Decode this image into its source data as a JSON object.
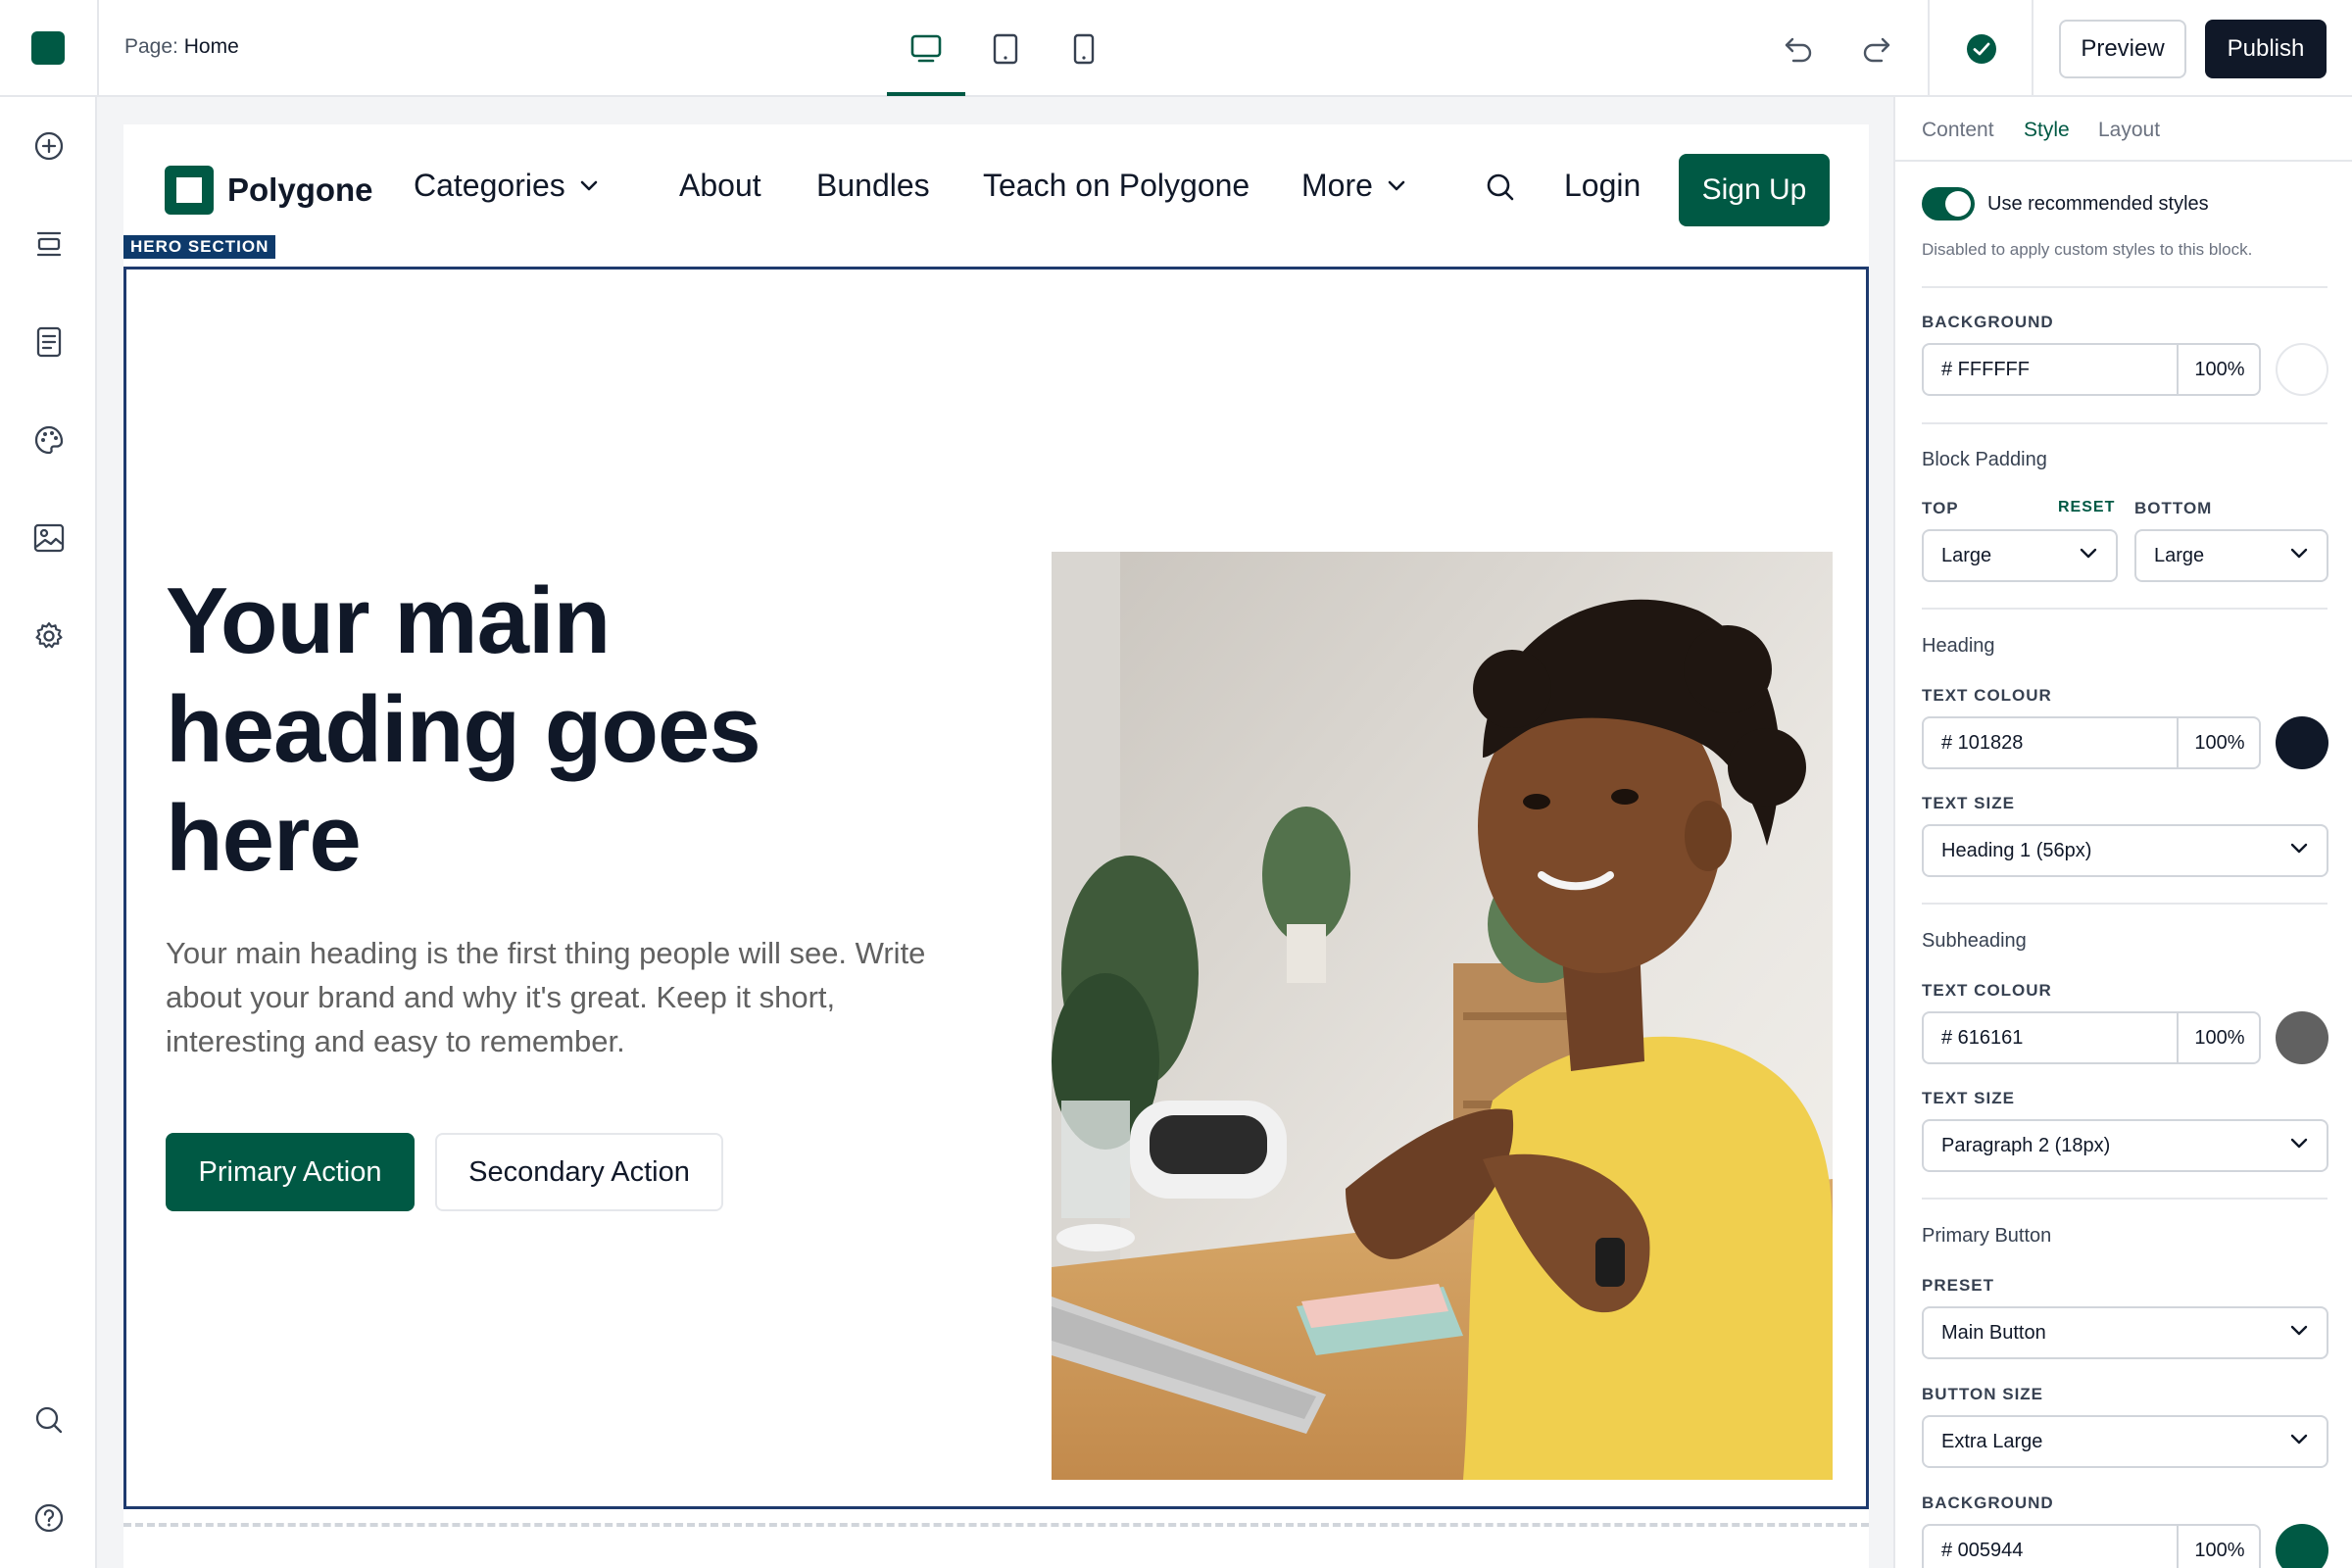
{
  "topbar": {
    "page_prefix": "Page:",
    "page_name": "Home",
    "preview_label": "Preview",
    "publish_label": "Publish"
  },
  "site": {
    "brand": "Polygone",
    "nav": {
      "categories": "Categories",
      "about": "About",
      "bundles": "Bundles",
      "teach": "Teach on Polygone",
      "more": "More",
      "login": "Login",
      "signup": "Sign Up"
    },
    "hero_tag": "HERO SECTION",
    "hero": {
      "heading": "Your main heading goes here",
      "subheading": "Your main heading is the first thing people will see. Write about your brand and why it's great. Keep it short, interesting and easy to remember.",
      "primary_action": "Primary Action",
      "secondary_action": "Secondary Action"
    }
  },
  "panel": {
    "tabs": [
      "Content",
      "Style",
      "Layout"
    ],
    "active_tab": "Style",
    "toggle_label": "Use recommended styles",
    "toggle_hint": "Disabled to apply custom styles to this block.",
    "background": {
      "caption": "BACKGROUND",
      "hex": "# FFFFFF",
      "opacity": "100%",
      "color": "#FFFFFF"
    },
    "block_padding": {
      "title": "Block Padding",
      "top_caption": "TOP",
      "reset": "RESET",
      "bottom_caption": "BOTTOM",
      "top_value": "Large",
      "bottom_value": "Large"
    },
    "heading": {
      "title": "Heading",
      "colour_caption": "TEXT COLOUR",
      "hex": "# 101828",
      "opacity": "100%",
      "color": "#101828",
      "size_caption": "TEXT SIZE",
      "size": "Heading 1 (56px)"
    },
    "subheading": {
      "title": "Subheading",
      "colour_caption": "TEXT COLOUR",
      "hex": "# 616161",
      "opacity": "100%",
      "color": "#616161",
      "size_caption": "TEXT SIZE",
      "size": "Paragraph 2 (18px)"
    },
    "primary_button": {
      "title": "Primary Button",
      "preset_caption": "PRESET",
      "preset": "Main Button",
      "size_caption": "BUTTON SIZE",
      "size": "Extra Large",
      "bg_caption": "BACKGROUND",
      "hex": "# 005944",
      "opacity": "100%",
      "color": "#005944"
    }
  },
  "colors": {
    "brand": "#005944",
    "dark": "#101828",
    "hero_border": "#1e3a6e"
  },
  "icons": [
    "add-block-icon",
    "sections-icon",
    "pages-icon",
    "palette-icon",
    "image-icon",
    "settings-icon",
    "search-icon",
    "help-icon",
    "desktop-icon",
    "tablet-icon",
    "mobile-icon",
    "undo-icon",
    "redo-icon",
    "saved-check-icon"
  ]
}
